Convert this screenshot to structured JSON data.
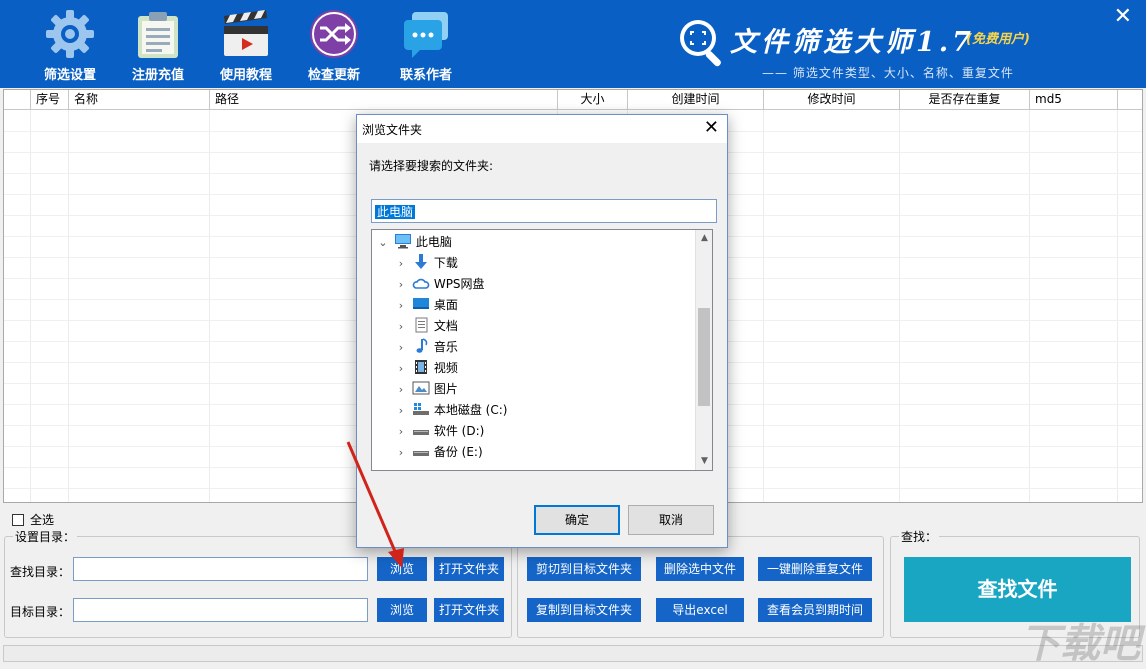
{
  "header": {
    "tools": [
      {
        "label": "筛选设置",
        "icon": "gear-icon"
      },
      {
        "label": "注册充值",
        "icon": "clipboard-icon"
      },
      {
        "label": "使用教程",
        "icon": "clapperboard-icon"
      },
      {
        "label": "检查更新",
        "icon": "shuffle-icon"
      },
      {
        "label": "联系作者",
        "icon": "chat-icon"
      }
    ],
    "close": "✕",
    "brand_title": "文件筛选大师1.7",
    "brand_free": "(免费用户)",
    "brand_subtitle": "—— 筛选文件类型、大小、名称、重复文件"
  },
  "grid": {
    "columns": [
      "",
      "序号",
      "名称",
      "路径",
      "大小",
      "创建时间",
      "修改时间",
      "是否存在重复",
      "md5"
    ]
  },
  "bottom": {
    "select_all": "全选",
    "group_dir": "设置目录：",
    "find_dir_label": "查找目录：",
    "target_dir_label": "目标目录：",
    "find_dir_value": "",
    "target_dir_value": "",
    "browse": "浏览",
    "open_folder": "打开文件夹",
    "cut_to_target": "剪切到目标文件夹",
    "copy_to_target": "复制到目标文件夹",
    "delete_selected": "删除选中文件",
    "export_excel": "导出excel",
    "delete_duplicates": "一键删除重复文件",
    "member_expiry": "查看会员到期时间",
    "group_find": "查找：",
    "find_files": "查找文件",
    "watermark": "下载吧"
  },
  "dialog": {
    "title": "浏览文件夹",
    "close": "✕",
    "prompt": "请选择要搜索的文件夹:",
    "selected_path": "此电脑",
    "tree": {
      "root": "此电脑",
      "items": [
        {
          "label": "下载",
          "icon": "download-arrow-icon"
        },
        {
          "label": "WPS网盘",
          "icon": "cloud-icon"
        },
        {
          "label": "桌面",
          "icon": "desktop-icon"
        },
        {
          "label": "文档",
          "icon": "document-icon"
        },
        {
          "label": "音乐",
          "icon": "music-note-icon"
        },
        {
          "label": "视频",
          "icon": "film-icon"
        },
        {
          "label": "图片",
          "icon": "picture-icon"
        },
        {
          "label": "本地磁盘 (C:)",
          "icon": "windows-drive-icon"
        },
        {
          "label": "软件 (D:)",
          "icon": "drive-icon"
        },
        {
          "label": "备份 (E:)",
          "icon": "drive-icon"
        }
      ]
    },
    "ok": "确定",
    "cancel": "取消"
  },
  "colors": {
    "header_bg": "#0a5fc4",
    "button_blue": "#1565c8",
    "find_button": "#19a6c2",
    "annotation_arrow": "#d0241b"
  }
}
